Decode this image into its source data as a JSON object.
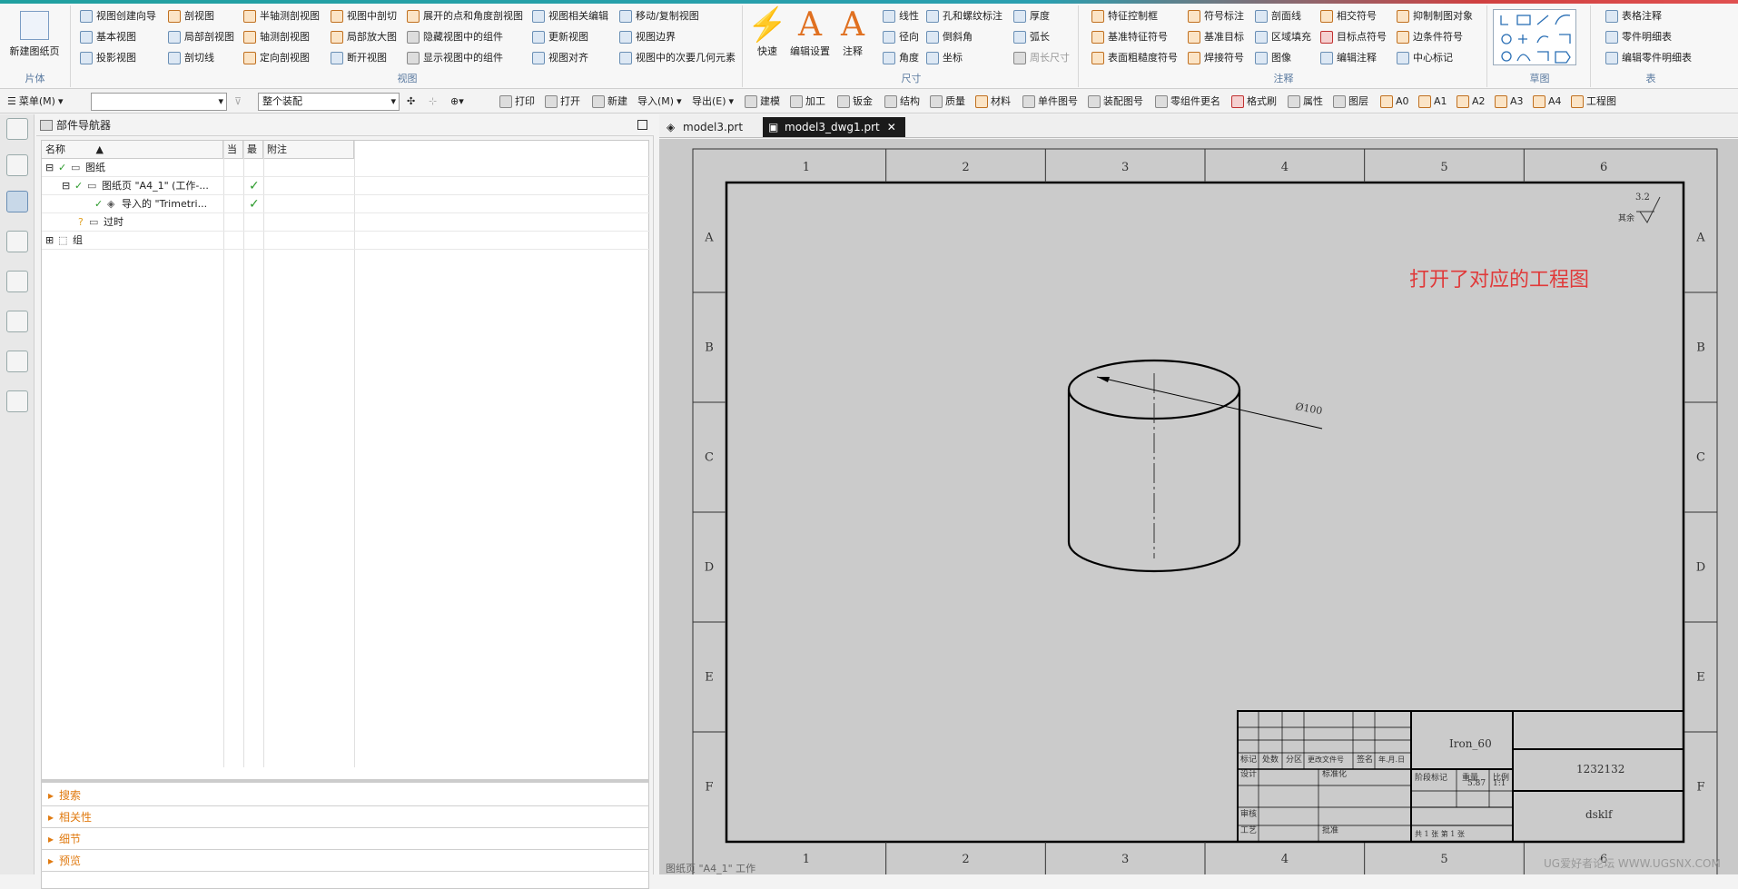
{
  "ribbon": {
    "new_sheet": "新建图纸页",
    "groups": {
      "sheet": "片体",
      "view": "视图",
      "dim": "尺寸",
      "anno": "注释",
      "sketch": "草图",
      "table": "表"
    },
    "view_cmds": [
      "视图创建向导",
      "基本视图",
      "投影视图",
      "剖视图",
      "局部剖视图",
      "剖切线",
      "半轴测剖视图",
      "轴测剖视图",
      "定向剖视图",
      "视图中剖切",
      "局部放大图",
      "断开视图",
      "展开的点和角度剖视图",
      "隐藏视图中的组件",
      "显示视图中的组件",
      "视图相关编辑",
      "更新视图",
      "视图对齐",
      "移动/复制视图",
      "视图边界",
      "视图中的次要几何元素"
    ],
    "big_cmds": [
      "快速",
      "编辑设置",
      "注释"
    ],
    "dim_cmds": [
      "线性",
      "径向",
      "角度",
      "孔和螺纹标注",
      "倒斜角",
      "坐标",
      "厚度",
      "弧长",
      "周长尺寸"
    ],
    "anno_cmds": [
      "特征控制框",
      "基准特征符号",
      "表面粗糙度符号",
      "符号标注",
      "基准目标",
      "焊接符号",
      "剖面线",
      "区域填充",
      "图像",
      "相交符号",
      "目标点符号",
      "编辑注释",
      "抑制制图对象",
      "边条件符号",
      "中心标记"
    ],
    "table_cmds": [
      "表格注释",
      "零件明细表",
      "编辑零件明细表"
    ]
  },
  "toolbar2": {
    "menu": "菜单(M)",
    "filter_value": "",
    "assembly_scope": "整个装配",
    "items": [
      "打印",
      "打开",
      "新建",
      "导入(M)",
      "导出(E)",
      "建模",
      "加工",
      "钣金",
      "结构",
      "质量",
      "材料",
      "单件图号",
      "装配图号",
      "零组件更名",
      "格式刷",
      "属性",
      "图层",
      "A0",
      "A1",
      "A2",
      "A3",
      "A4",
      "工程图"
    ]
  },
  "navigator": {
    "title": "部件导航器",
    "columns": [
      "名称",
      "当",
      "最",
      "附注"
    ],
    "rows": [
      {
        "label": "图纸",
        "check": ""
      },
      {
        "label": "图纸页 \"A4_1\" (工作-...",
        "check": "✓"
      },
      {
        "label": "导入的 \"Trimetri...",
        "check": "✓"
      },
      {
        "label": "过时",
        "check": ""
      },
      {
        "label": "组",
        "check": ""
      }
    ],
    "panels": [
      "搜索",
      "相关性",
      "细节",
      "预览"
    ]
  },
  "tabs": [
    "model3.prt",
    "model3_dwg1.prt"
  ],
  "drawing": {
    "col_labels": [
      "1",
      "2",
      "3",
      "4",
      "5",
      "6"
    ],
    "row_labels": [
      "A",
      "B",
      "C",
      "D",
      "E",
      "F"
    ],
    "dimension": "Ø100",
    "roughness_value": "3.2",
    "roughness_note": "其余",
    "title_block": {
      "material": "Iron_60",
      "drawing_no": "1232132",
      "company": "dsklf",
      "mass": "5.87",
      "scale": "1:1",
      "row_headers": [
        "标记",
        "处数",
        "分区",
        "更改文件号",
        "签名",
        "年.月.日"
      ],
      "labels": {
        "design": "设计",
        "standardize": "标准化",
        "stage": "阶段标记",
        "weight": "重量",
        "ratio": "比例",
        "review": "审核",
        "craft": "工艺",
        "approve": "批准",
        "sheets": "共 1 张    第 1 张"
      }
    },
    "overlay_note": "打开了对应的工程图",
    "sheet_status": "图纸页 \"A4_1\" 工作",
    "watermark": "UG爱好者论坛 WWW.UGSNX.COM"
  }
}
